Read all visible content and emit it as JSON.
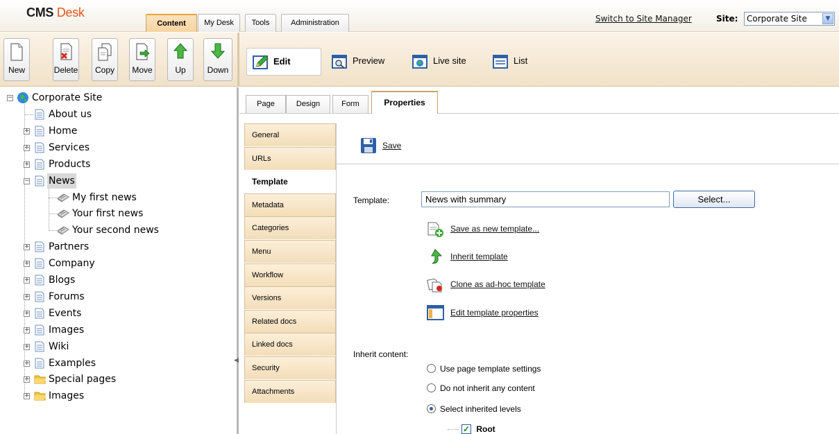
{
  "header": {
    "logo_main": "CMS",
    "logo_accent": "Desk",
    "tabs": [
      {
        "label": "Content",
        "active": true
      },
      {
        "label": "My Desk",
        "active": false
      },
      {
        "label": "Tools",
        "active": false
      },
      {
        "label": "Administration",
        "active": false
      }
    ],
    "switch_link": "Switch to Site Manager",
    "site_label": "Site:",
    "site_value": "Corporate Site"
  },
  "toolbar": {
    "actions": [
      {
        "label": "New",
        "icon": "page-new-icon"
      },
      {
        "label": "Delete",
        "icon": "page-delete-icon"
      },
      {
        "label": "Copy",
        "icon": "copy-icon"
      },
      {
        "label": "Move",
        "icon": "move-icon"
      },
      {
        "label": "Up",
        "icon": "arrow-up-icon"
      },
      {
        "label": "Down",
        "icon": "arrow-down-icon"
      }
    ],
    "views": [
      {
        "label": "Edit",
        "icon": "edit-icon",
        "active": true
      },
      {
        "label": "Preview",
        "icon": "preview-icon"
      },
      {
        "label": "Live site",
        "icon": "live-site-icon"
      },
      {
        "label": "List",
        "icon": "list-icon"
      }
    ]
  },
  "tree": {
    "root": "Corporate Site",
    "items": [
      {
        "label": "About us",
        "icon": "page-icon"
      },
      {
        "label": "Home",
        "icon": "page-icon"
      },
      {
        "label": "Services",
        "icon": "page-icon"
      },
      {
        "label": "Products",
        "icon": "page-icon"
      },
      {
        "label": "News",
        "icon": "page-icon",
        "selected": true
      },
      {
        "label": "My first news",
        "icon": "news-icon"
      },
      {
        "label": "Your first news",
        "icon": "news-icon"
      },
      {
        "label": "Your second news",
        "icon": "news-icon"
      },
      {
        "label": "Partners",
        "icon": "page-icon"
      },
      {
        "label": "Company",
        "icon": "page-icon"
      },
      {
        "label": "Blogs",
        "icon": "page-icon"
      },
      {
        "label": "Forums",
        "icon": "page-icon"
      },
      {
        "label": "Events",
        "icon": "page-icon"
      },
      {
        "label": "Images",
        "icon": "page-icon"
      },
      {
        "label": "Wiki",
        "icon": "page-icon"
      },
      {
        "label": "Examples",
        "icon": "page-icon"
      },
      {
        "label": "Special pages",
        "icon": "folder-icon"
      },
      {
        "label": "Images",
        "icon": "folder-icon"
      }
    ]
  },
  "subtabs": [
    {
      "label": "Page"
    },
    {
      "label": "Design"
    },
    {
      "label": "Form"
    },
    {
      "label": "Properties",
      "active": true
    }
  ],
  "property_tabs": [
    {
      "label": "General"
    },
    {
      "label": "URLs"
    },
    {
      "label": "Template",
      "active": true
    },
    {
      "label": "Metadata"
    },
    {
      "label": "Categories"
    },
    {
      "label": "Menu"
    },
    {
      "label": "Workflow"
    },
    {
      "label": "Versions"
    },
    {
      "label": "Related docs"
    },
    {
      "label": "Linked docs"
    },
    {
      "label": "Security"
    },
    {
      "label": "Attachments"
    }
  ],
  "template_panel": {
    "save_label": "Save",
    "template_label": "Template:",
    "template_value": "News with summary",
    "select_button": "Select...",
    "actions": [
      {
        "label": "Save as new template...",
        "icon": "save-template-icon"
      },
      {
        "label": "Inherit template",
        "icon": "inherit-icon"
      },
      {
        "label": "Clone as ad-hoc template",
        "icon": "clone-icon"
      },
      {
        "label": "Edit template properties",
        "icon": "template-properties-icon"
      }
    ],
    "inherit_label": "Inherit content:",
    "inherit_options": [
      {
        "label": "Use page template settings",
        "checked": false
      },
      {
        "label": "Do not inherit any content",
        "checked": false
      },
      {
        "label": "Select inherited levels",
        "checked": true
      }
    ],
    "levels": [
      {
        "label": "Root",
        "checked": true
      }
    ]
  },
  "colors": {
    "accent_orange": "#e8a33b",
    "logo_orange": "#e6561b",
    "tab_active_bg": "#f7d3a0",
    "vtab_bg": "#f3ddb8"
  }
}
